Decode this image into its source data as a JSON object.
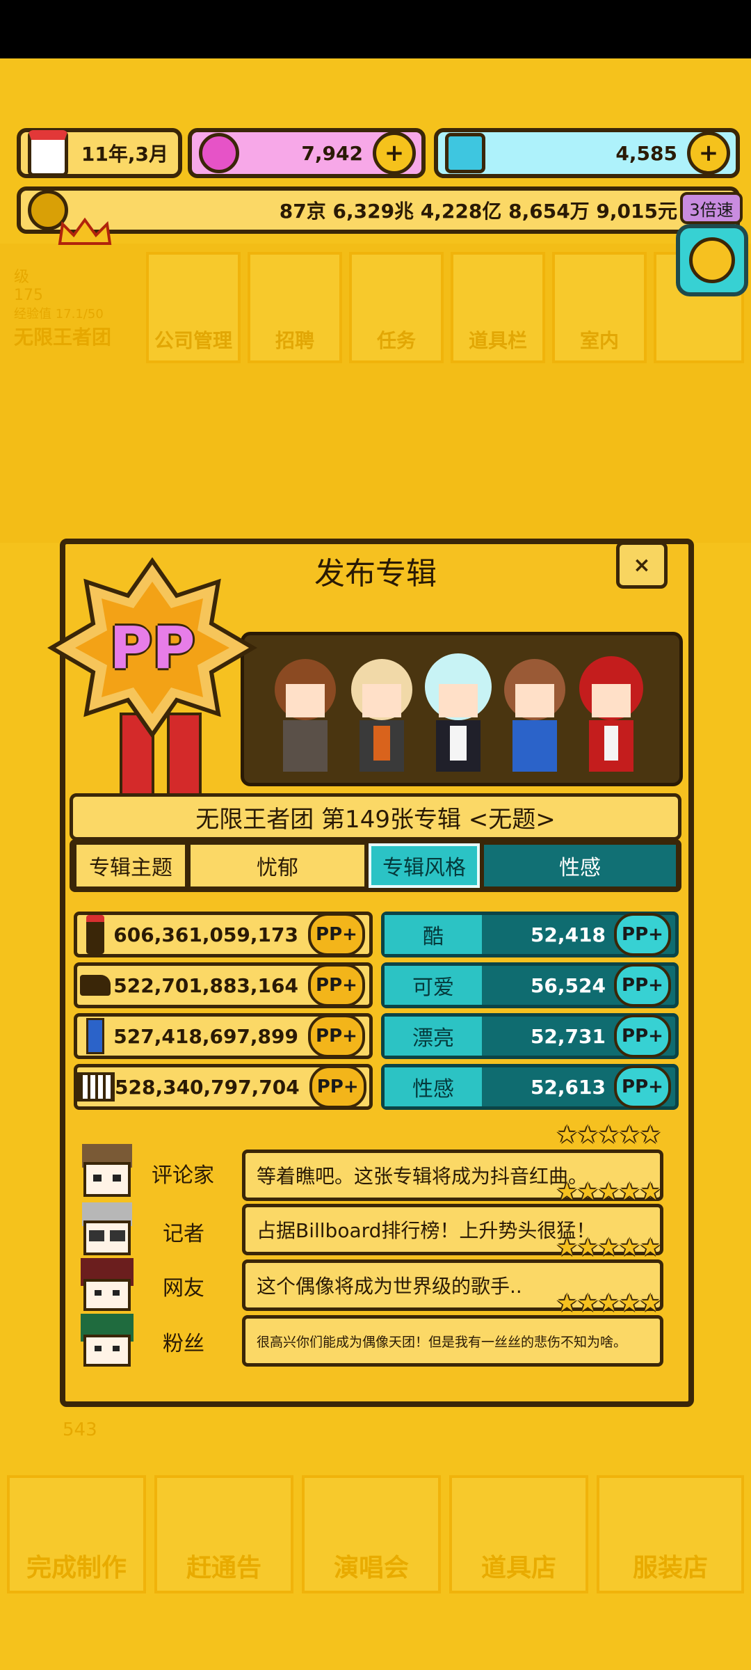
{
  "status_bar": {},
  "top": {
    "date": "11年,3月",
    "pink_currency": "7,942",
    "cyan_currency": "4,585",
    "money": "87京 6,329兆 4,228亿 8,654万 9,015元",
    "speed": "3倍速"
  },
  "background": {
    "level_label": "级",
    "level_value": "175",
    "exp_label": "经验值 17.1/50",
    "group_name": "无限王者团",
    "menu_tabs": [
      "公司管理",
      "招聘",
      "任务",
      "道具栏",
      "室内"
    ],
    "bottom_tabs": [
      "完成制作",
      "赶通告",
      "演唱会",
      "道具店",
      "服装店"
    ],
    "star_count": "543"
  },
  "dialog": {
    "title": "发布专辑",
    "close_label": "×",
    "badge_text": "PP",
    "album_line": "无限王者团 第149张专辑 <无题>",
    "theme_label": "专辑主题",
    "theme_value": "忧郁",
    "style_label": "专辑风格",
    "style_value": "性感",
    "pp_label": "PP+",
    "left_stats": [
      "606,361,059,173",
      "522,701,883,164",
      "527,418,697,899",
      "528,340,797,704"
    ],
    "left_stat_icons": [
      "microphone-icon",
      "shoe-icon",
      "pen-icon",
      "piano-icon"
    ],
    "right_stats": [
      {
        "label": "酷",
        "value": "52,418"
      },
      {
        "label": "可爱",
        "value": "56,524"
      },
      {
        "label": "漂亮",
        "value": "52,731"
      },
      {
        "label": "性感",
        "value": "52,613"
      }
    ],
    "reviews": [
      {
        "role": "评论家",
        "text": "等着瞧吧。这张专辑将成为抖音红曲。",
        "stars": 5
      },
      {
        "role": "记者",
        "text": "占据Billboard排行榜！上升势头很猛！",
        "stars": 5
      },
      {
        "role": "网友",
        "text": "这个偶像将成为世界级的歌手..",
        "stars": 5
      },
      {
        "role": "粉丝",
        "text": "很高兴你们能成为偶像天团！但是我有一丝丝的悲伤不知为啥。",
        "stars": 5
      }
    ]
  },
  "colors": {
    "background": "#f5c21c",
    "panel_border": "#3a2608",
    "teal": "#117074",
    "light_teal": "#2bc3c5",
    "pink": "#f7a8e8",
    "cyan_bar": "#aef2fb"
  }
}
